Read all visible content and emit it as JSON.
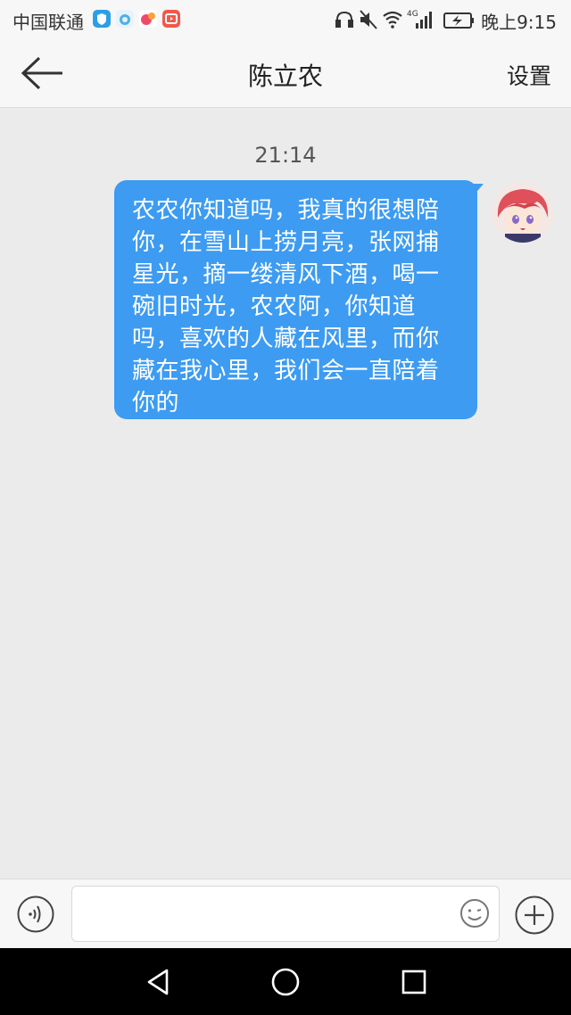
{
  "status_bar": {
    "carrier": "中国联通",
    "time": "晚上9:15",
    "network": "4G",
    "app_icons": [
      "shield-app-icon",
      "cloud-app-icon",
      "paint-app-icon",
      "video-app-icon"
    ],
    "status_icons": [
      "headphone-icon",
      "mute-icon",
      "wifi-icon",
      "signal-icon",
      "battery-charging-icon"
    ]
  },
  "header": {
    "title": "陈立农",
    "settings_label": "设置"
  },
  "chat": {
    "timestamp": "21:14",
    "messages": [
      {
        "sender": "self",
        "lines": [
          "农农你知道吗，我真的很想陪",
          "你，在雪山上捞月亮，张网捕",
          "星光，摘一缕清风下酒，喝一",
          "碗旧时光，农农阿，你知道",
          "吗，喜欢的人藏在风里，而你",
          "藏在我心里，我们会一直陪着",
          "你的"
        ]
      }
    ]
  },
  "input_bar": {
    "value": "",
    "placeholder": ""
  },
  "colors": {
    "bubble": "#3d9bf2",
    "background": "#ebebeb",
    "bar": "#f7f7f7",
    "nav": "#000000"
  }
}
